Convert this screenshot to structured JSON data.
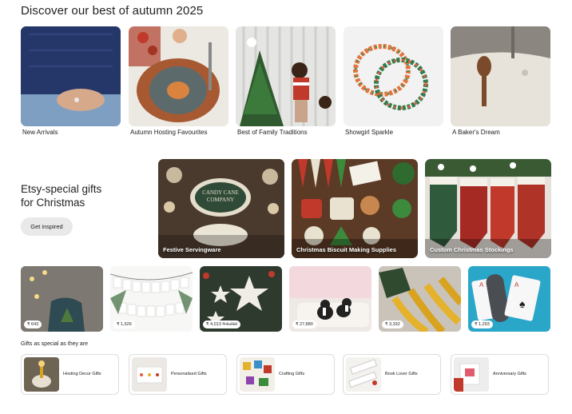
{
  "discover": {
    "heading": "Discover our best of autumn 2025",
    "categories": [
      {
        "label": "New Arrivals"
      },
      {
        "label": "Autumn Hosting Favourites"
      },
      {
        "label": "Best of Family Traditions"
      },
      {
        "label": "Showgirl Sparkle"
      },
      {
        "label": "A Baker's Dream"
      }
    ]
  },
  "promo": {
    "title_line1": "Etsy-special gifts",
    "title_line2": "for Christmas",
    "button_label": "Get inspired",
    "cards": [
      {
        "label": "Festive Servingware"
      },
      {
        "label": "Christmas Biscuit Making Supplies"
      },
      {
        "label": "Custom Christmas Stockings"
      }
    ]
  },
  "products": [
    {
      "price": "₹ 643",
      "original": ""
    },
    {
      "price": "₹ 1,626",
      "original": ""
    },
    {
      "price": "₹ 4,013",
      "original": "₹ 5,019"
    },
    {
      "price": "₹ 27,880",
      "original": ""
    },
    {
      "price": "₹ 3,332",
      "original": ""
    },
    {
      "price": "₹ 1,293",
      "original": ""
    }
  ],
  "gifts": {
    "title": "Gifts as special as they are",
    "items": [
      {
        "label": "Hosting Decor Gifts"
      },
      {
        "label": "Personalised Gifts"
      },
      {
        "label": "Crafting Gifts"
      },
      {
        "label": "Book Lover Gifts"
      },
      {
        "label": "Anniversary Gifts"
      }
    ]
  },
  "colors": {
    "text": "#222222",
    "button_bg": "#e9e9e9",
    "card_border": "#dddddd"
  }
}
